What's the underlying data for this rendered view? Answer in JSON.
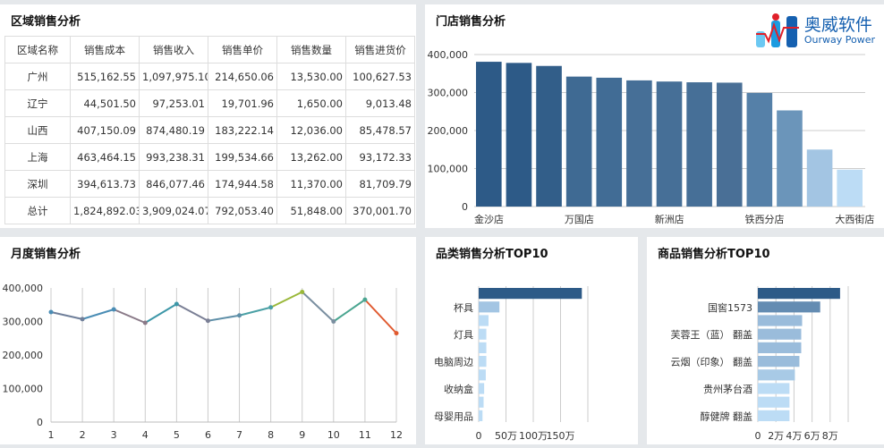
{
  "region": {
    "title": "区域销售分析",
    "headers": [
      "区域名称",
      "销售成本",
      "销售收入",
      "销售单价",
      "销售数量",
      "销售进货价"
    ],
    "rows": [
      [
        "广州",
        "515,162.55",
        "1,097,975.10",
        "214,650.06",
        "13,530.00",
        "100,627.53"
      ],
      [
        "辽宁",
        "44,501.50",
        "97,253.01",
        "19,701.96",
        "1,650.00",
        "9,013.48"
      ],
      [
        "山西",
        "407,150.09",
        "874,480.19",
        "183,222.14",
        "12,036.00",
        "85,478.57"
      ],
      [
        "上海",
        "463,464.15",
        "993,238.31",
        "199,534.66",
        "13,262.00",
        "93,172.33"
      ],
      [
        "深圳",
        "394,613.73",
        "846,077.46",
        "174,944.58",
        "11,370.00",
        "81,709.79"
      ],
      [
        "总计",
        "1,824,892.03",
        "3,909,024.07",
        "792,053.40",
        "51,848.00",
        "370,001.70"
      ]
    ]
  },
  "logo": {
    "cn": "奥威软件",
    "en": "Ourway Power"
  },
  "chart_data": [
    {
      "type": "bar",
      "title": "门店销售分析",
      "categories": [
        "金沙店",
        "",
        "",
        "万国店",
        "",
        "",
        "新洲店",
        "",
        "",
        "铁西分店",
        "",
        "",
        "大西街店"
      ],
      "values": [
        381000,
        378000,
        370000,
        342000,
        339000,
        332000,
        329000,
        327000,
        326000,
        299000,
        253000,
        150000,
        97000
      ],
      "yticks": [
        "0",
        "100,000",
        "200,000",
        "300,000",
        "400,000"
      ],
      "ylim": [
        0,
        400000
      ],
      "colors": [
        "#2d5a87",
        "#2d5a87",
        "#325e89",
        "#3f6a93",
        "#416c95",
        "#466f97",
        "#466f97",
        "#466f97",
        "#496f96",
        "#5580a8",
        "#6b95ba",
        "#a3c5e3",
        "#bcdcf5"
      ]
    },
    {
      "type": "line",
      "title": "月度销售分析",
      "x": [
        "1",
        "2",
        "3",
        "4",
        "5",
        "6",
        "7",
        "8",
        "9",
        "10",
        "11",
        "12"
      ],
      "values": [
        328000,
        307000,
        336000,
        296000,
        352000,
        302000,
        318000,
        342000,
        388000,
        300000,
        365000,
        265000
      ],
      "yticks": [
        "0",
        "100,000",
        "200,000",
        "300,000",
        "400,000"
      ],
      "ylim": [
        0,
        400000
      ],
      "colors": [
        "#4a8db5",
        "#6f7f9a",
        "#4a8db5",
        "#8a7a88",
        "#3d97a8",
        "#7a7f95",
        "#5f8fa8",
        "#4aa0a5",
        "#9ab83a",
        "#7a8fa0",
        "#4aa590",
        "#e05a30"
      ]
    },
    {
      "type": "hbar",
      "title": "品类销售分析TOP10",
      "labels": [
        "",
        "杯具",
        "",
        "灯具",
        "",
        "电脑周边",
        "",
        "收纳盒",
        "",
        "母婴用品"
      ],
      "values": [
        189,
        38,
        18,
        14,
        14,
        14,
        13,
        10,
        9,
        7
      ],
      "unit": "万",
      "xticks": [
        "0",
        "50万",
        "100万",
        "150万"
      ],
      "xlim": [
        0,
        200
      ],
      "colors": [
        "#2d5a87",
        "#a3c5e3",
        "#bcdcf5",
        "#bcdcf5",
        "#bcdcf5",
        "#bcdcf5",
        "#bcdcf5",
        "#bcdcf5",
        "#bcdcf5",
        "#bcdcf5"
      ]
    },
    {
      "type": "hbar",
      "title": "商品销售分析TOP10",
      "labels": [
        "",
        "国窖1573",
        "",
        "芙蓉王（蓝） 翻盖",
        "",
        "云烟（印象） 翻盖",
        "",
        "贵州茅台酒",
        "",
        "醇健牌 翻盖"
      ],
      "values": [
        9.1,
        6.9,
        4.9,
        4.8,
        4.8,
        4.6,
        4.1,
        3.5,
        3.5,
        3.5
      ],
      "unit": "万",
      "xticks": [
        "0",
        "2万",
        "4万",
        "6万",
        "8万"
      ],
      "xlim": [
        0,
        10
      ],
      "colors": [
        "#2d5a87",
        "#648cb2",
        "#9abcdb",
        "#9abcdb",
        "#9abcdb",
        "#9abcdb",
        "#a8cae6",
        "#bcdcf5",
        "#bcdcf5",
        "#bcdcf5"
      ]
    }
  ]
}
